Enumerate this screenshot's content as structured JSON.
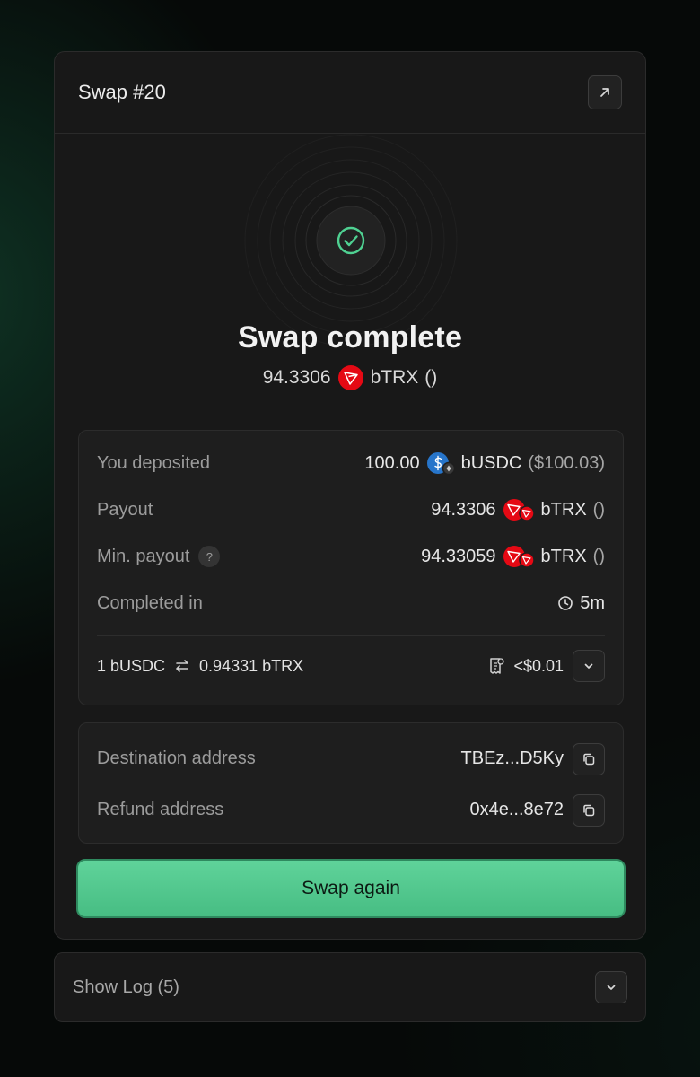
{
  "card": {
    "title": "Swap #20",
    "open_icon": "external-link-icon"
  },
  "status": {
    "title": "Swap complete",
    "amount": "94.3306",
    "token": "bTRX",
    "usd": "()",
    "icon": "check-circle-icon",
    "accent_color": "#4fd192"
  },
  "details": {
    "deposited": {
      "label": "You deposited",
      "amount": "100.00",
      "token": "bUSDC",
      "usd": "($100.03)",
      "icon": "usdc-token-icon"
    },
    "payout": {
      "label": "Payout",
      "amount": "94.3306",
      "token": "bTRX",
      "usd": "()",
      "icon": "trx-token-icon"
    },
    "min_payout": {
      "label": "Min. payout",
      "help": "?",
      "amount": "94.33059",
      "token": "bTRX",
      "usd": "()",
      "icon": "trx-token-icon"
    },
    "completed": {
      "label": "Completed in",
      "value": "5m",
      "icon": "clock-icon"
    },
    "rate": {
      "from": "1 bUSDC",
      "to": "0.94331 bTRX",
      "icon": "swap-arrows-icon"
    },
    "fee": {
      "value": "<$0.01",
      "icon": "receipt-icon"
    }
  },
  "addresses": {
    "destination": {
      "label": "Destination address",
      "value": "TBEz...D5Ky"
    },
    "refund": {
      "label": "Refund address",
      "value": "0x4e...8e72"
    }
  },
  "actions": {
    "swap_again": "Swap again"
  },
  "log": {
    "label": "Show Log (5)"
  },
  "colors": {
    "trx_red": "#e50914",
    "usdc_blue": "#2775ca",
    "button_green": "#52c98d"
  }
}
